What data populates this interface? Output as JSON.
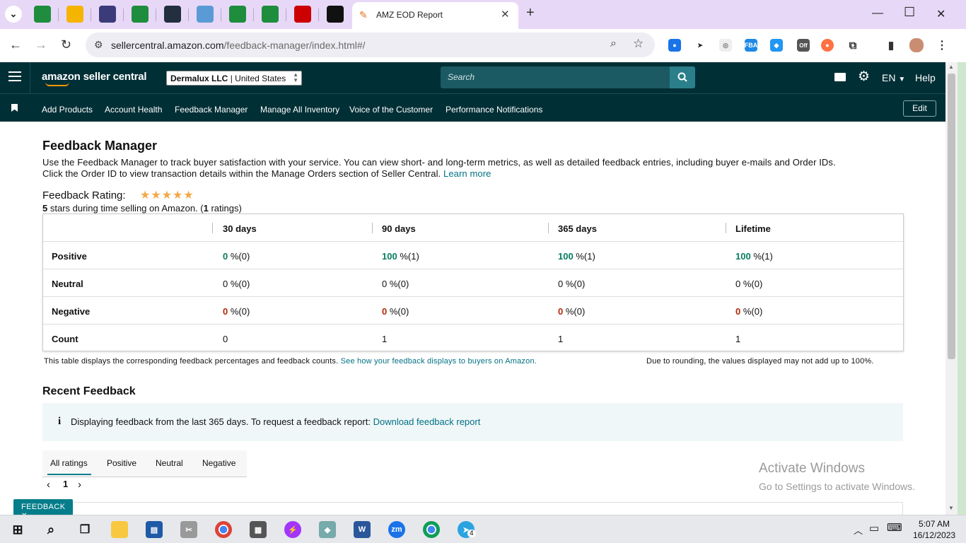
{
  "browser": {
    "active_tab_title": "AMZ EOD Report",
    "new_tab": "+",
    "url_host": "sellercentral.amazon.com",
    "url_path": "/feedback-manager/index.html#/",
    "extension_badge": "Off",
    "tabs": [
      {
        "icon": "sheets-icon",
        "color": "#1e8e3e"
      },
      {
        "icon": "drive-icon",
        "color": "#f4b400"
      },
      {
        "icon": "ab-icon",
        "color": "#3b3b7a"
      },
      {
        "icon": "sheets-icon",
        "color": "#1e8e3e"
      },
      {
        "icon": "amazon-icon",
        "color": "#232f3e"
      },
      {
        "icon": "cube-icon",
        "color": "#5b9bd5"
      },
      {
        "icon": "sheets-icon",
        "color": "#1e8e3e"
      },
      {
        "icon": "sheets-icon",
        "color": "#1e8e3e"
      },
      {
        "icon": "triangle-icon",
        "color": "#c00"
      },
      {
        "icon": "amazon-icon",
        "color": "#111"
      }
    ]
  },
  "header": {
    "logo": "amazon seller central",
    "account": "Dermalux LLC | United States",
    "account_name": "Dermalux LLC",
    "account_region": "| United States",
    "search_placeholder": "Search",
    "language": "EN",
    "help": "Help"
  },
  "nav": {
    "items": [
      "Add Products",
      "Account Health",
      "Feedback Manager",
      "Manage All Inventory",
      "Voice of the Customer",
      "Performance Notifications"
    ],
    "edit": "Edit"
  },
  "page": {
    "title": "Feedback Manager",
    "intro_1": "Use the Feedback Manager to track buyer satisfaction with your service. You can view short- and long-term metrics, as well as detailed feedback entries, including buyer e-mails and Order IDs.",
    "intro_2": "Click the Order ID to view transaction details within the Manage Orders section of Seller Central.",
    "learn_more": "Learn more",
    "rating_label": "Feedback Rating:",
    "stars": 5,
    "rating_stars_value": "5",
    "rating_mid": " stars during time selling on Amazon. (",
    "rating_count": "1",
    "rating_end": " ratings)",
    "columns": [
      "30 days",
      "90 days",
      "365 days",
      "Lifetime"
    ],
    "rows": [
      {
        "label": "Positive",
        "values": [
          "0",
          "100",
          "100",
          "100"
        ],
        "counts": [
          "%(0)",
          "%(1)",
          "%(1)",
          "%(1)"
        ],
        "tone": "g"
      },
      {
        "label": "Neutral",
        "values": [
          "0",
          "0",
          "0",
          "0"
        ],
        "counts": [
          "%(0)",
          "%(0)",
          "%(0)",
          "%(0)"
        ],
        "tone": ""
      },
      {
        "label": "Negative",
        "values": [
          "0",
          "0",
          "0",
          "0"
        ],
        "counts": [
          "%(0)",
          "%(0)",
          "%(0)",
          "%(0)"
        ],
        "tone": "r"
      },
      {
        "label": "Count",
        "values": [
          "0",
          "1",
          "1",
          "1"
        ],
        "counts": [
          "",
          "",
          "",
          ""
        ],
        "tone": ""
      }
    ],
    "table_note": "This table displays the corresponding feedback percentages and feedback counts.",
    "table_note_link": "See how your feedback displays to buyers on Amazon.",
    "rounding_note": "Due to rounding, the values displayed may not add up to 100%.",
    "recent_title": "Recent Feedback",
    "info_text": "Displaying feedback from the last 365 days. To request a feedback report:",
    "info_link": "Download feedback report",
    "filter_tabs": [
      "All ratings",
      "Positive",
      "Neutral",
      "Negative"
    ],
    "page_number": "1",
    "feedback_tab": "FEEDBACK"
  },
  "watermark": {
    "line1": "Activate Windows",
    "line2": "Go to Settings to activate Windows."
  },
  "taskbar": {
    "time": "5:07 AM",
    "date": "16/12/2023",
    "telegram_badge": "4"
  }
}
